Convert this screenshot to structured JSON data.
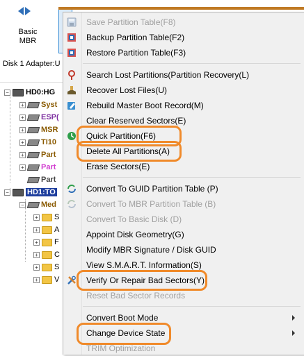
{
  "toolbar": {
    "disk_button_line1": "Basic",
    "disk_button_line2": "MBR"
  },
  "infobar": {
    "text": "Disk  1 Adapter:U"
  },
  "tree": {
    "disk0": "HD0:HG",
    "disk0_partitions": [
      "Syst",
      "ESP(",
      "MSR",
      "TI10",
      "Part",
      "Part",
      "Part"
    ],
    "disk1": "HD1:TO",
    "disk1_partition": "Med",
    "folders": [
      "S",
      "A",
      "F",
      "C",
      "S",
      "V"
    ]
  },
  "menu": {
    "items": [
      {
        "label": "Save Partition Table(F8)",
        "disabled": true
      },
      {
        "label": "Backup Partition Table(F2)",
        "disabled": false
      },
      {
        "label": "Restore Partition Table(F3)",
        "disabled": false
      },
      {
        "label": "Search Lost Partitions(Partition Recovery(L)",
        "disabled": false
      },
      {
        "label": "Recover Lost Files(U)",
        "disabled": false
      },
      {
        "label": "Rebuild Master Boot Record(M)",
        "disabled": false
      },
      {
        "label": "Clear Reserved Sectors(E)",
        "disabled": false
      },
      {
        "label": "Quick Partition(F6)",
        "disabled": false
      },
      {
        "label": "Delete All Partitions(A)",
        "disabled": false
      },
      {
        "label": "Erase Sectors(E)",
        "disabled": false
      },
      {
        "label": "Convert To GUID Partition Table (P)",
        "disabled": false
      },
      {
        "label": "Convert To MBR Partition Table (B)",
        "disabled": true
      },
      {
        "label": "Convert To Basic Disk (D)",
        "disabled": true
      },
      {
        "label": "Appoint Disk Geometry(G)",
        "disabled": false
      },
      {
        "label": "Modify MBR Signature / Disk GUID",
        "disabled": false
      },
      {
        "label": "View S.M.A.R.T. Information(S)",
        "disabled": false
      },
      {
        "label": "Verify Or Repair Bad Sectors(Y)",
        "disabled": false
      },
      {
        "label": "Reset Bad Sector Records",
        "disabled": true
      },
      {
        "label": "Convert Boot Mode",
        "disabled": false
      },
      {
        "label": "Change Device State",
        "disabled": false
      },
      {
        "label": "TRIM Optimization",
        "disabled": true
      }
    ]
  },
  "colors": {
    "highlight_ring": "#f08a2a",
    "tree_blue": "#1f3f9e",
    "tree_red": "#c0392b",
    "tree_purple": "#7d2fa0"
  }
}
